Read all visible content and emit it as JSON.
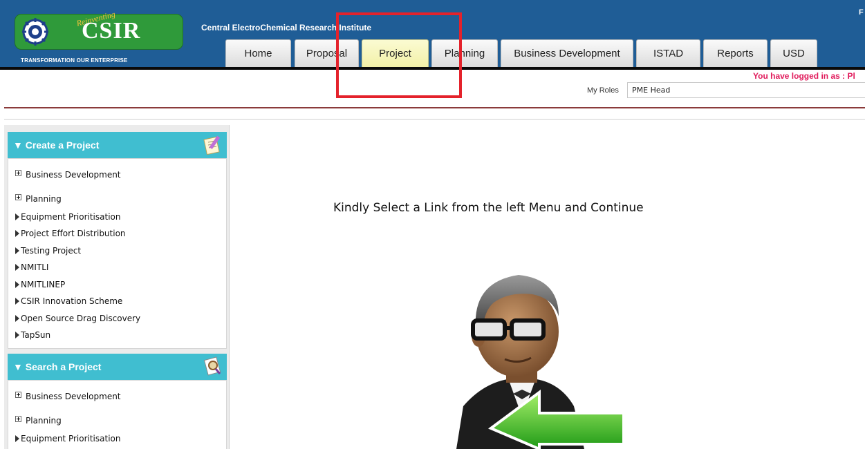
{
  "header": {
    "logo_text": "CSIR",
    "logo_script": "Reinventing",
    "tagline": "TRANSFORMATION OUR ENTERPRISE",
    "institute": "Central ElectroChemical Research Institute",
    "corner_letter": "F",
    "brand_color": "#1f5d96"
  },
  "tabs": [
    {
      "label": "Home"
    },
    {
      "label": "Proposal"
    },
    {
      "label": "Project",
      "active": true
    },
    {
      "label": "Planning"
    },
    {
      "label": "Business Development"
    },
    {
      "label": "ISTAD"
    },
    {
      "label": "Reports"
    },
    {
      "label": "USD"
    }
  ],
  "user": {
    "login_text": "You have logged in as : Pl",
    "roles_label": "My Roles",
    "roles_value": "PME Head"
  },
  "sidebar": {
    "create_panel": {
      "title": "▼ Create a Project",
      "icon": "pencil-notepad-icon",
      "items": [
        {
          "label": "Business Development",
          "type": "expand"
        },
        {
          "label": "Planning",
          "type": "expand"
        },
        {
          "label": "Equipment Prioritisation",
          "type": "arrow"
        },
        {
          "label": "Project Effort Distribution",
          "type": "arrow"
        },
        {
          "label": "Testing Project",
          "type": "arrow"
        },
        {
          "label": "NMITLI",
          "type": "arrow"
        },
        {
          "label": "NMITLINEP",
          "type": "arrow"
        },
        {
          "label": "CSIR Innovation Scheme",
          "type": "arrow"
        },
        {
          "label": "Open Source Drag Discovery",
          "type": "arrow"
        },
        {
          "label": "TapSun",
          "type": "arrow"
        }
      ]
    },
    "search_panel": {
      "title": "▼ Search a Project",
      "icon": "magnifier-document-icon",
      "items": [
        {
          "label": "Business Development",
          "type": "expand"
        },
        {
          "label": "Planning",
          "type": "expand"
        },
        {
          "label": "Equipment Prioritisation",
          "type": "arrow"
        }
      ]
    }
  },
  "main": {
    "message": "Kindly Select a Link from the left Menu and Continue",
    "illustration": "man-with-green-arrow-icon"
  },
  "colors": {
    "panel_header": "#40bed0",
    "active_tab": "#f2f0a8",
    "highlight": "#e4222b",
    "login_text": "#e0195a"
  }
}
